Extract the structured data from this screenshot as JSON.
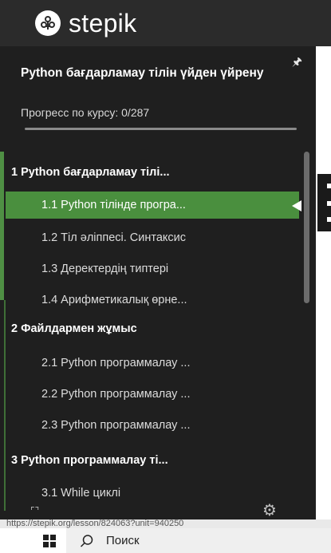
{
  "header": {
    "brand": "stepik"
  },
  "sidebar": {
    "course_title": "Python бағдарламау тілін үйден үйрену",
    "progress_label": "Прогресс по курсу:  0/287",
    "progress_fraction": 0.0,
    "sections": [
      {
        "label": "1  Python бағдарламау тілі...",
        "lessons": [
          {
            "label": "1.1  Python тілінде програ...",
            "active": true
          },
          {
            "label": "1.2  Тіл әліппесі. Синтаксис",
            "active": false
          },
          {
            "label": "1.3  Деректердің типтері",
            "active": false
          },
          {
            "label": "1.4  Арифметикалық өрне...",
            "active": false
          }
        ]
      },
      {
        "label": "2   Файлдармен жұмыс",
        "lessons": [
          {
            "label": "2.1  Python программалау ...",
            "active": false
          },
          {
            "label": "2.2  Python программалау ...",
            "active": false
          },
          {
            "label": "2.3  Python программалау ...",
            "active": false
          }
        ]
      },
      {
        "label": "3  Python программалау ті...",
        "lessons": [
          {
            "label": "3.1  While циклі",
            "active": false
          }
        ]
      }
    ]
  },
  "status_url": "https://stepik.org/lesson/824063?unit=940250",
  "taskbar": {
    "search_placeholder": "Поиск"
  },
  "colors": {
    "accent": "#4a8f3e",
    "sidebar_bg": "#1f1f1f",
    "header_bg": "#2b2b2b"
  }
}
